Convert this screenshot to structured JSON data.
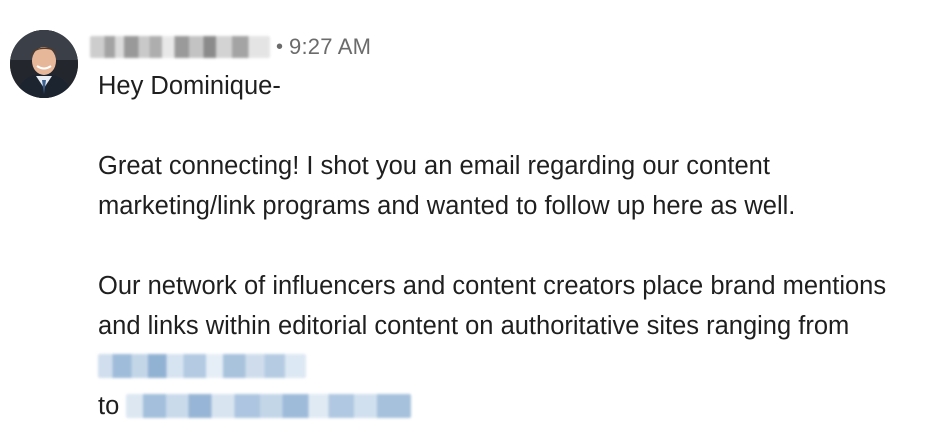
{
  "message": {
    "sender": {
      "name_redacted": true,
      "avatar": "profile-photo"
    },
    "separator": "•",
    "timestamp": "9:27 AM",
    "greeting": "Hey Dominique-",
    "paragraph1": "Great connecting! I shot you an email regarding our content marketing/link programs and wanted to follow up here as well.",
    "paragraph2_text": "Our network of influencers and content creators place brand mentions and links within editorial content on authoritative sites ranging from",
    "paragraph2_to": "to",
    "redacted_links": 2,
    "colors": {
      "text": "#1f1f1f",
      "timestamp": "#6b6b6b",
      "link_redaction": "#9bb9d8",
      "name_redaction": "#9a9a9a"
    }
  }
}
